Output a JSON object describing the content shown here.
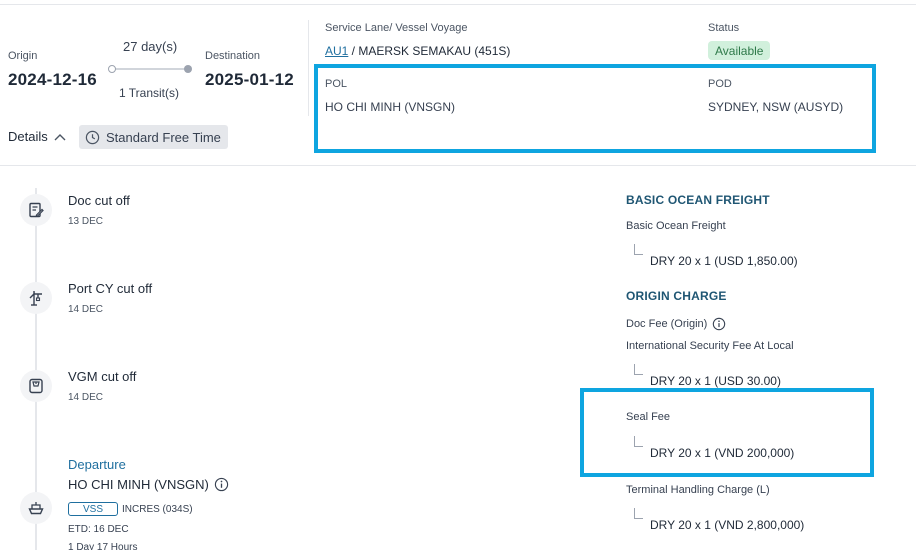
{
  "route": {
    "origin_label": "Origin",
    "origin_date": "2024-12-16",
    "destination_label": "Destination",
    "destination_date": "2025-01-12",
    "duration": "27 day(s)",
    "transits": "1 Transit(s)"
  },
  "details": {
    "toggle_label": "Details",
    "free_time_label": "Standard Free Time"
  },
  "service": {
    "label": "Service Lane/ Vessel Voyage",
    "lane_link": "AU1",
    "vessel_voyage": " / MAERSK SEMAKAU (451S)",
    "status_label": "Status",
    "status_value": "Available",
    "pol_label": "POL",
    "pol_value": "HO CHI MINH (VNSGN)",
    "pod_label": "POD",
    "pod_value": "SYDNEY, NSW (AUSYD)"
  },
  "timeline": {
    "events": [
      {
        "title": "Doc cut off",
        "date": "13 DEC",
        "icon": "document-edit-icon"
      },
      {
        "title": "Port CY cut off",
        "date": "14 DEC",
        "icon": "port-crane-icon"
      },
      {
        "title": "VGM cut off",
        "date": "14 DEC",
        "icon": "weight-scale-icon"
      }
    ],
    "departure": {
      "title": "Departure",
      "port": "HO CHI MINH (VNSGN)",
      "vessel_tag": "VSS",
      "vessel": "INCRES (034S)",
      "etd": "ETD: 16 DEC",
      "transit_time": "1 Day 17 Hours",
      "icon": "ship-icon"
    }
  },
  "charges": {
    "sections": [
      {
        "title": "BASIC OCEAN FREIGHT",
        "items": [
          {
            "name": "Basic Ocean Freight",
            "lines": [
              "DRY 20 x 1 (USD 1,850.00)"
            ]
          }
        ]
      },
      {
        "title": "ORIGIN CHARGE",
        "items": [
          {
            "name": "Doc Fee (Origin)",
            "info": true,
            "lines": []
          },
          {
            "name": "International Security Fee At Local",
            "lines": [
              "DRY 20 x 1 (USD 30.00)"
            ]
          },
          {
            "name": "Seal Fee",
            "lines": [
              "DRY 20 x 1 (VND 200,000)"
            ]
          },
          {
            "name": "Terminal Handling Charge (L)",
            "lines": [
              "DRY 20 x 1 (VND 2,800,000)"
            ]
          }
        ]
      }
    ]
  },
  "colors": {
    "accent_blue": "#1f6f9f",
    "highlight_box": "#0ea5e0",
    "status_bg": "#d1f0dc",
    "status_text": "#2f7a4a"
  }
}
